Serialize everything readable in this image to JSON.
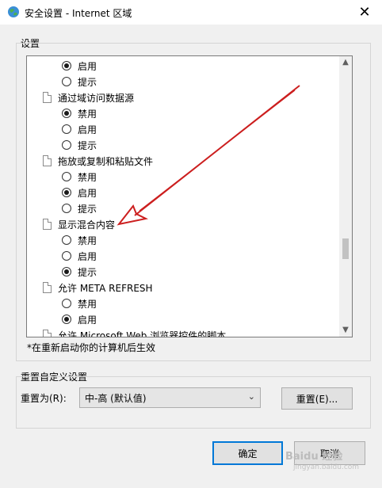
{
  "window": {
    "title": "安全设置 - Internet 区域",
    "close_icon": "close-icon"
  },
  "settings_group": {
    "label": "设置"
  },
  "list": [
    {
      "kind": "option",
      "label": "启用",
      "checked": true
    },
    {
      "kind": "option",
      "label": "提示",
      "checked": false
    },
    {
      "kind": "category",
      "label": "通过域访问数据源"
    },
    {
      "kind": "option",
      "label": "禁用",
      "checked": true
    },
    {
      "kind": "option",
      "label": "启用",
      "checked": false
    },
    {
      "kind": "option",
      "label": "提示",
      "checked": false
    },
    {
      "kind": "category",
      "label": "拖放或复制和粘贴文件"
    },
    {
      "kind": "option",
      "label": "禁用",
      "checked": false
    },
    {
      "kind": "option",
      "label": "启用",
      "checked": true
    },
    {
      "kind": "option",
      "label": "提示",
      "checked": false
    },
    {
      "kind": "category",
      "label": "显示混合内容"
    },
    {
      "kind": "option",
      "label": "禁用",
      "checked": false
    },
    {
      "kind": "option",
      "label": "启用",
      "checked": false
    },
    {
      "kind": "option",
      "label": "提示",
      "checked": true
    },
    {
      "kind": "category",
      "label": "允许 META REFRESH"
    },
    {
      "kind": "option",
      "label": "禁用",
      "checked": false
    },
    {
      "kind": "option",
      "label": "启用",
      "checked": true
    },
    {
      "kind": "category",
      "label": "允许 Microsoft Web 浏览器控件的脚本"
    }
  ],
  "note": "*在重新启动你的计算机后生效",
  "reset_group": {
    "label": "重置自定义设置",
    "reset_to_label": "重置为(R):",
    "selected": "中-高 (默认值)",
    "reset_button": "重置(E)..."
  },
  "buttons": {
    "ok": "确定",
    "cancel": "取消"
  },
  "watermark": {
    "text": "Baidu 经验",
    "sub": "jingyan.baidu.com"
  },
  "colors": {
    "annotation_arrow": "#cc1f1f",
    "default_button_border": "#0078d7"
  }
}
